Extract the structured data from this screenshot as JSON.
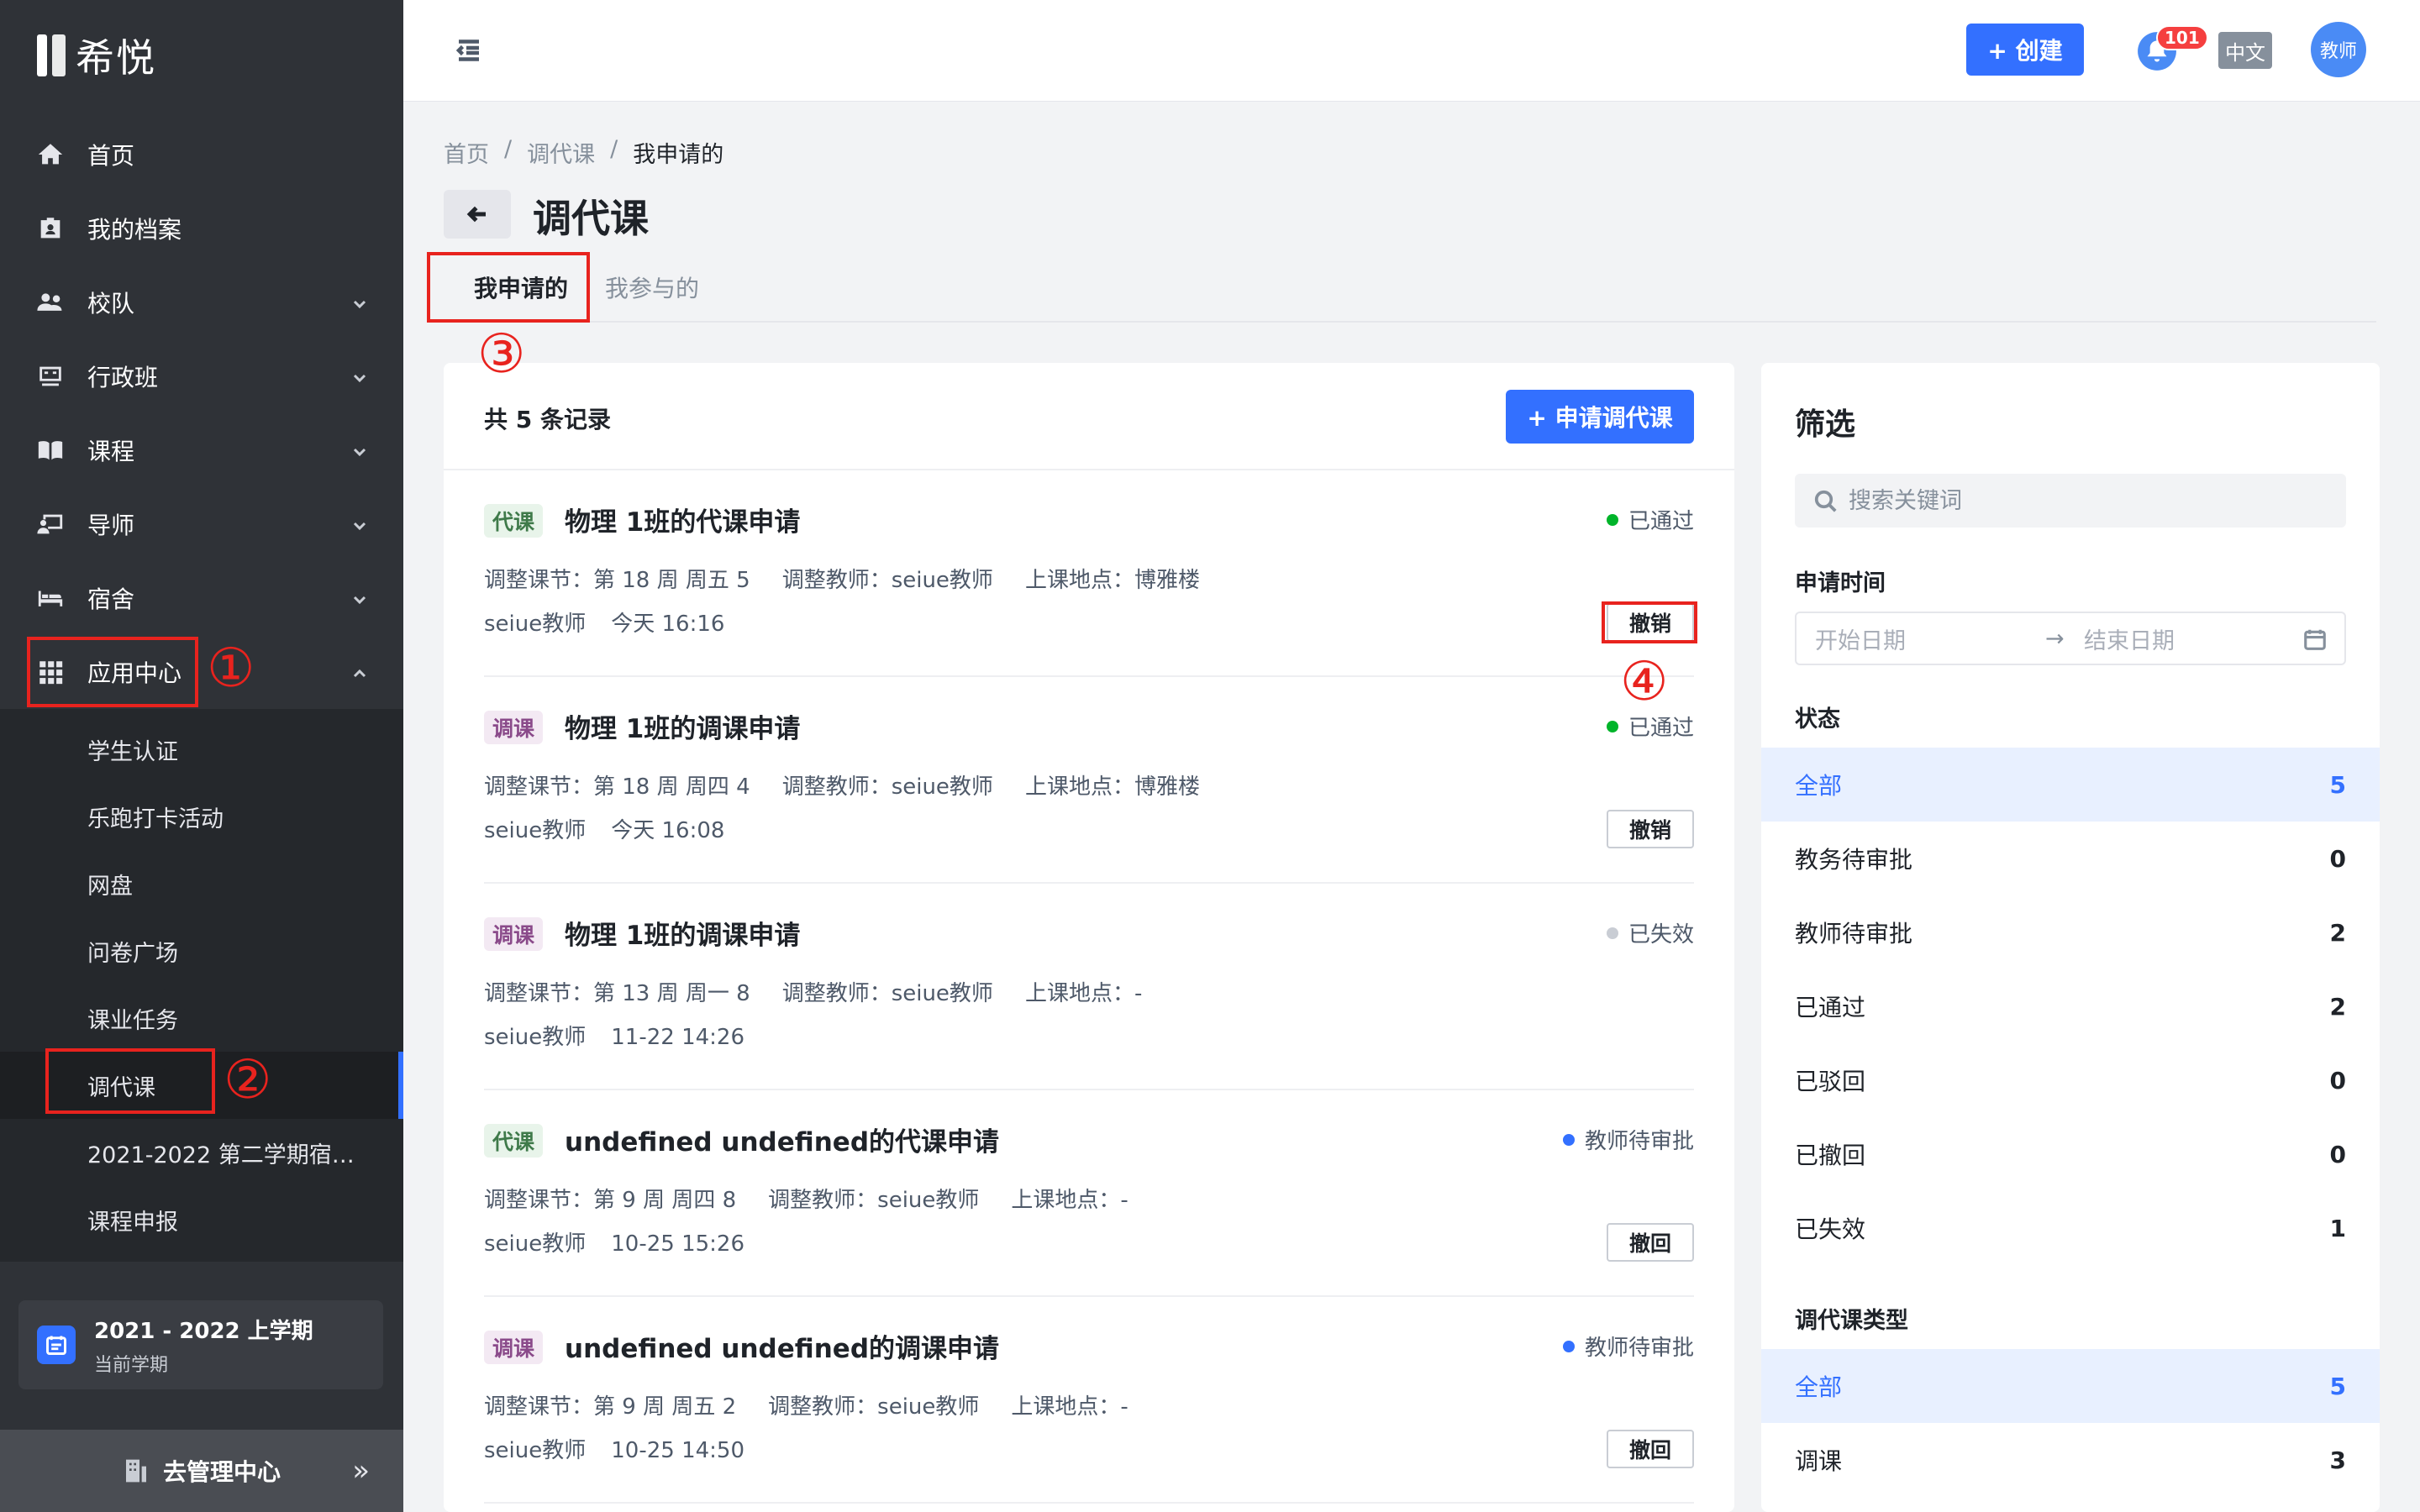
{
  "app": {
    "logo_text": "希悦"
  },
  "sidebar": {
    "items": [
      {
        "label": "首页",
        "icon": "home-icon"
      },
      {
        "label": "我的档案",
        "icon": "profile-icon"
      },
      {
        "label": "校队",
        "icon": "team-icon"
      },
      {
        "label": "行政班",
        "icon": "class-icon"
      },
      {
        "label": "课程",
        "icon": "book-icon"
      },
      {
        "label": "导师",
        "icon": "mentor-icon"
      },
      {
        "label": "宿舍",
        "icon": "bed-icon"
      },
      {
        "label": "应用中心",
        "icon": "apps-icon"
      }
    ],
    "sub_items": [
      "学生认证",
      "乐跑打卡活动",
      "网盘",
      "问卷广场",
      "课业任务",
      "调代课",
      "2021-2022 第二学期宿舍...",
      "课程申报"
    ],
    "term": {
      "title": "2021 - 2022 上学期",
      "subtitle": "当前学期"
    },
    "admin_label": "去管理中心",
    "admin_chevron": "»"
  },
  "annotations": [
    "①",
    "②",
    "③",
    "④"
  ],
  "header": {
    "create_label": "+ 创建",
    "notification_count": "101",
    "lang_label": "中文",
    "avatar_label": "教师"
  },
  "breadcrumb": {
    "items": [
      "首页",
      "调代课",
      "我申请的"
    ],
    "separator": "/"
  },
  "page": {
    "title": "调代课"
  },
  "tabs": [
    "我申请的",
    "我参与的"
  ],
  "list": {
    "count_text": "共 5 条记录",
    "apply_label": "+ 申请调代课",
    "records": [
      {
        "tag": "代课",
        "title": "物理 1班的代课申请",
        "status": "已通过",
        "status_color": "#00b42a",
        "lesson": "调整课节：第 18 周 周五 5",
        "teacher": "调整教师：seiue教师",
        "location": "上课地点：博雅楼",
        "author": "seiue教师",
        "time": "今天 16:16",
        "action": "撤销"
      },
      {
        "tag": "调课",
        "title": "物理 1班的调课申请",
        "status": "已通过",
        "status_color": "#00b42a",
        "lesson": "调整课节：第 18 周 周四 4",
        "teacher": "调整教师：seiue教师",
        "location": "上课地点：博雅楼",
        "author": "seiue教师",
        "time": "今天 16:08",
        "action": "撤销"
      },
      {
        "tag": "调课",
        "title": "物理 1班的调课申请",
        "status": "已失效",
        "status_color": "#c9cdd4",
        "lesson": "调整课节：第 13 周 周一 8",
        "teacher": "调整教师：seiue教师",
        "location": "上课地点：-",
        "author": "seiue教师",
        "time": "11-22 14:26",
        "action": ""
      },
      {
        "tag": "代课",
        "title": "undefined undefined的代课申请",
        "status": "教师待审批",
        "status_color": "#3370ff",
        "lesson": "调整课节：第 9 周 周四 8",
        "teacher": "调整教师：seiue教师",
        "location": "上课地点：-",
        "author": "seiue教师",
        "time": "10-25 15:26",
        "action": "撤回"
      },
      {
        "tag": "调课",
        "title": "undefined undefined的调课申请",
        "status": "教师待审批",
        "status_color": "#3370ff",
        "lesson": "调整课节：第 9 周 周五 2",
        "teacher": "调整教师：seiue教师",
        "location": "上课地点：-",
        "author": "seiue教师",
        "time": "10-25 14:50",
        "action": "撤回"
      }
    ]
  },
  "filter": {
    "title": "筛选",
    "search_placeholder": "搜索关键词",
    "time_label": "申请时间",
    "start_placeholder": "开始日期",
    "range_arrow": "→",
    "end_placeholder": "结束日期",
    "status_label": "状态",
    "status_options": [
      {
        "label": "全部",
        "count": "5"
      },
      {
        "label": "教务待审批",
        "count": "0"
      },
      {
        "label": "教师待审批",
        "count": "2"
      },
      {
        "label": "已通过",
        "count": "2"
      },
      {
        "label": "已驳回",
        "count": "0"
      },
      {
        "label": "已撤回",
        "count": "0"
      },
      {
        "label": "已失效",
        "count": "1"
      }
    ],
    "type_label": "调代课类型",
    "type_options": [
      {
        "label": "全部",
        "count": "5"
      },
      {
        "label": "调课",
        "count": "3"
      }
    ]
  },
  "colors": {
    "accent": "#3370ff",
    "sidebar_bg": "#2f3237",
    "annotation": "#e8231e",
    "tag_daike_bg": "#e8f4ea",
    "tag_daike_fg": "#3f7a4a",
    "tag_tiaoke_bg": "#f3e9f3",
    "tag_tiaoke_fg": "#8a4a8a"
  }
}
